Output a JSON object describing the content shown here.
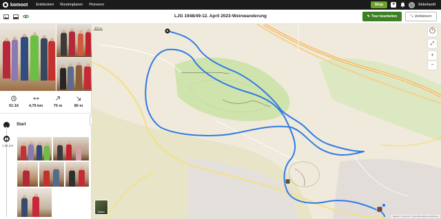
{
  "brand": {
    "name": "komoot"
  },
  "nav": {
    "items": [
      "Entdecken",
      "Routenplaner",
      "Pioneers"
    ]
  },
  "header": {
    "shop_label": "Shop",
    "username": "Ekkehardt"
  },
  "subbar": {
    "title": "LJG 1948/49-12. April 2023-Weinwanderung",
    "edit_label": "Tour bearbeiten",
    "shrink_label": "Verkleinern"
  },
  "stats": [
    {
      "icon": "clock-icon",
      "value": "01:16"
    },
    {
      "icon": "distance-icon",
      "value": "4,79 km"
    },
    {
      "icon": "ascent-icon",
      "value": "70 m"
    },
    {
      "icon": "descent-icon",
      "value": "80 m"
    }
  ],
  "timeline": {
    "start_label": "Start",
    "photo_time": "1:32 pm"
  },
  "map": {
    "scale_label": "300 m",
    "karten_label": "Karten",
    "attribution": "Mapbox © komoot © OpenStreetMap contributors"
  },
  "colors": {
    "accent": "#3d7f23",
    "route": "#2f7ae5",
    "topbar": "#1b1b1b"
  }
}
